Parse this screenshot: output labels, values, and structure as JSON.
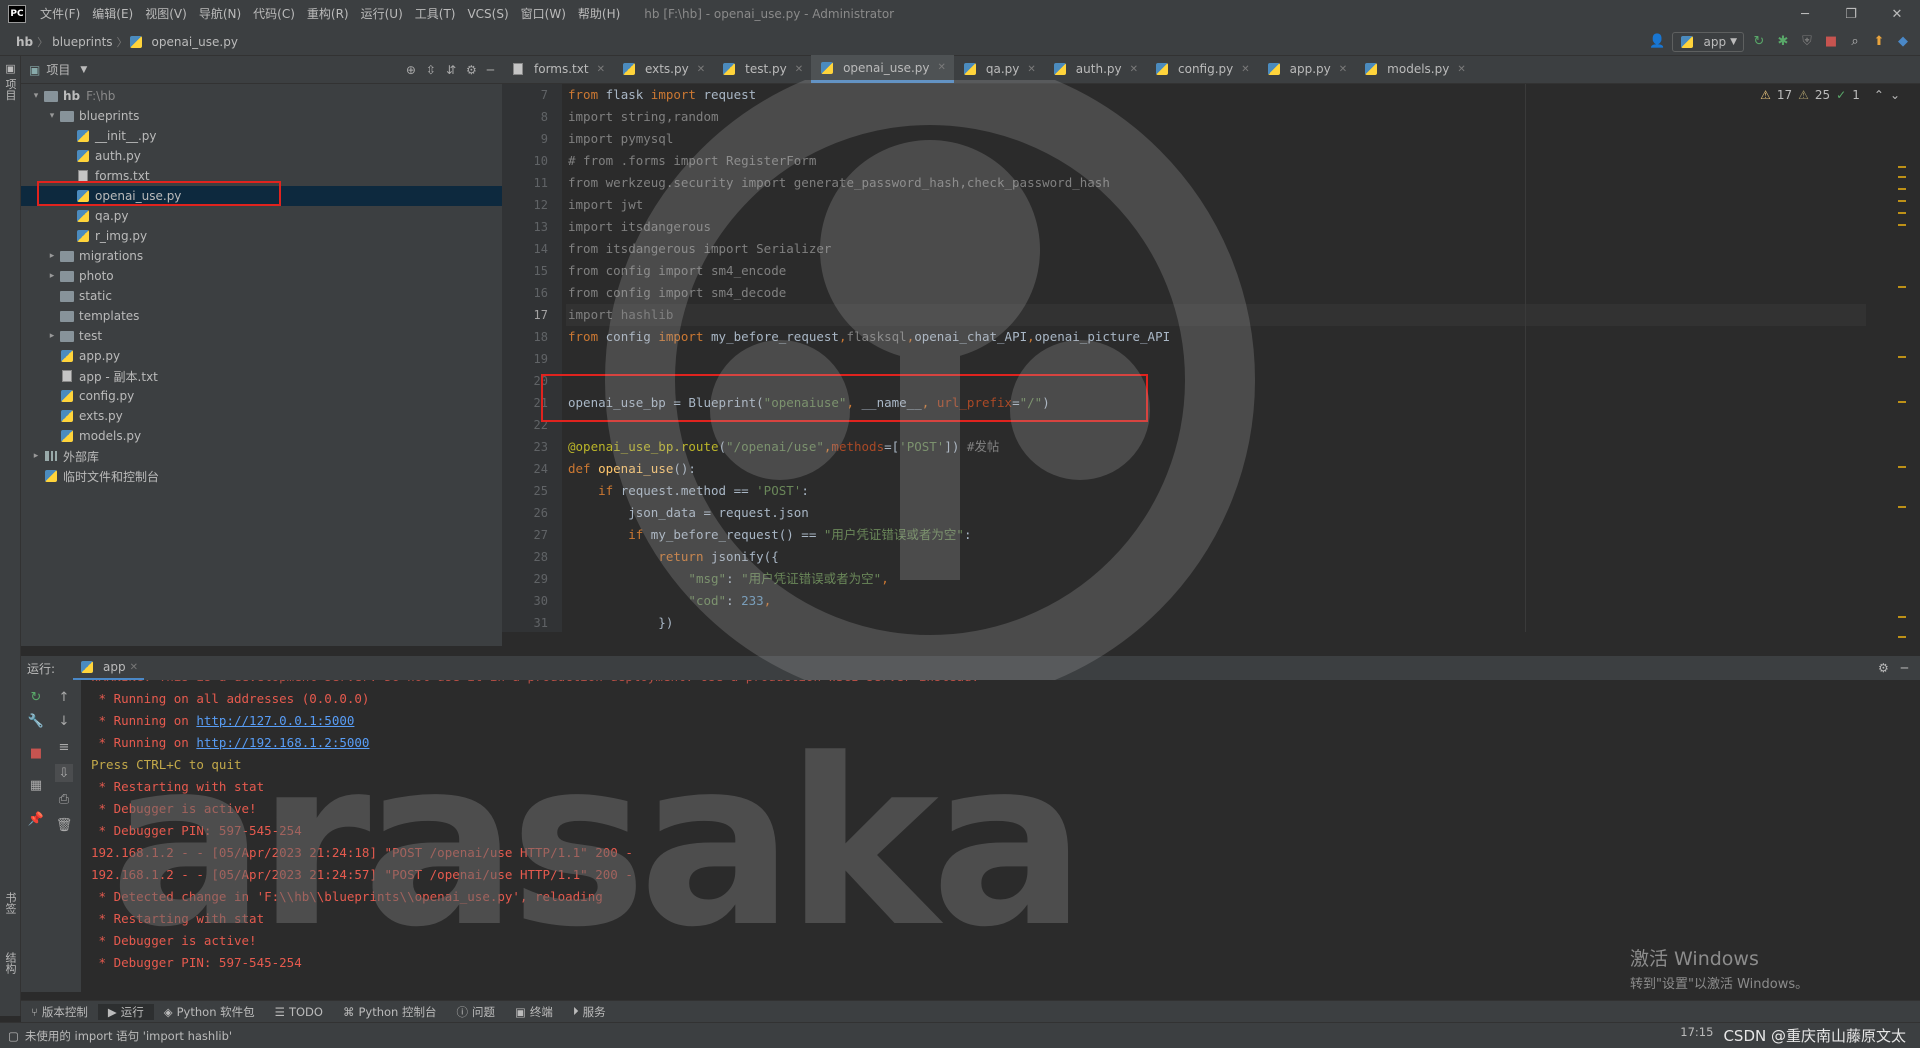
{
  "titlebar": {
    "logo": "PC",
    "menus": [
      "文件(F)",
      "编辑(E)",
      "视图(V)",
      "导航(N)",
      "代码(C)",
      "重构(R)",
      "运行(U)",
      "工具(T)",
      "VCS(S)",
      "窗口(W)",
      "帮助(H)"
    ],
    "window_title": "hb [F:\\hb] - openai_use.py - Administrator"
  },
  "breadcrumb": [
    "hb",
    "blueprints",
    "openai_use.py"
  ],
  "run_config": "app",
  "project": {
    "title": "项目",
    "root": {
      "name": "hb",
      "path": "F:\\hb"
    },
    "tree": [
      {
        "label": "hb",
        "sub": "F:\\hb",
        "type": "folder",
        "depth": 0,
        "open": true
      },
      {
        "label": "blueprints",
        "type": "folder",
        "depth": 1,
        "open": true
      },
      {
        "label": "__init__.py",
        "type": "py",
        "depth": 2
      },
      {
        "label": "auth.py",
        "type": "py",
        "depth": 2
      },
      {
        "label": "forms.txt",
        "type": "txt",
        "depth": 2
      },
      {
        "label": "openai_use.py",
        "type": "py",
        "depth": 2,
        "selected": true
      },
      {
        "label": "qa.py",
        "type": "py",
        "depth": 2
      },
      {
        "label": "r_img.py",
        "type": "py",
        "depth": 2
      },
      {
        "label": "migrations",
        "type": "folder",
        "depth": 1,
        "closed": true
      },
      {
        "label": "photo",
        "type": "folder",
        "depth": 1,
        "closed": true
      },
      {
        "label": "static",
        "type": "folder",
        "depth": 1
      },
      {
        "label": "templates",
        "type": "folder",
        "depth": 1
      },
      {
        "label": "test",
        "type": "folder",
        "depth": 1,
        "closed": true
      },
      {
        "label": "app.py",
        "type": "py",
        "depth": 1
      },
      {
        "label": "app - 副本.txt",
        "type": "txt",
        "depth": 1
      },
      {
        "label": "config.py",
        "type": "py",
        "depth": 1
      },
      {
        "label": "exts.py",
        "type": "py",
        "depth": 1
      },
      {
        "label": "models.py",
        "type": "py",
        "depth": 1
      },
      {
        "label": "外部库",
        "type": "lib",
        "depth": 0,
        "closed": true
      },
      {
        "label": "临时文件和控制台",
        "type": "scratch",
        "depth": 0
      }
    ]
  },
  "editor": {
    "tabs": [
      "forms.txt",
      "exts.py",
      "test.py",
      "openai_use.py",
      "qa.py",
      "auth.py",
      "config.py",
      "app.py",
      "models.py"
    ],
    "active_tab": "openai_use.py",
    "inspections": {
      "warnings": "17",
      "weak_warnings": "25",
      "ok": "1"
    },
    "line_numbers": [
      "7",
      "8",
      "9",
      "10",
      "11",
      "12",
      "13",
      "14",
      "15",
      "16",
      "17",
      "18",
      "19",
      "20",
      "21",
      "22",
      "23",
      "24",
      "25",
      "26",
      "27",
      "28",
      "29",
      "30",
      "31"
    ],
    "current_line": "17"
  },
  "run": {
    "label": "运行:",
    "tab": "app",
    "console": [
      {
        "text": "WARNING: This is a development server. Do not use it in a production deployment. Use a production WSGI server instead.",
        "cls": ""
      },
      {
        "text": " * Running on all addresses (0.0.0.0)",
        "cls": ""
      },
      {
        "pre": " * Running on ",
        "link": "http://127.0.0.1:5000",
        "cls": ""
      },
      {
        "pre": " * Running on ",
        "link": "http://192.168.1.2:5000",
        "cls": ""
      },
      {
        "text": "Press CTRL+C to quit",
        "cls": "y"
      },
      {
        "text": " * Restarting with stat",
        "cls": ""
      },
      {
        "text": " * Debugger is active!",
        "cls": ""
      },
      {
        "text": " * Debugger PIN: 597-545-254",
        "cls": ""
      },
      {
        "text": "192.168.1.2 - - [05/Apr/2023 21:24:18] \"POST /openai/use HTTP/1.1\" 200 -",
        "cls": ""
      },
      {
        "text": "192.168.1.2 - - [05/Apr/2023 21:24:57] \"POST /openai/use HTTP/1.1\" 200 -",
        "cls": ""
      },
      {
        "text": " * Detected change in 'F:\\\\hb\\\\blueprints\\\\openai_use.py', reloading",
        "cls": ""
      },
      {
        "text": " * Restarting with stat",
        "cls": ""
      },
      {
        "text": " * Debugger is active!",
        "cls": ""
      },
      {
        "text": " * Debugger PIN: 597-545-254",
        "cls": ""
      }
    ]
  },
  "windows_activation": {
    "line1": "激活 Windows",
    "line2": "转到\"设置\"以激活 Windows。"
  },
  "bottom_tabs": [
    "版本控制",
    "运行",
    "Python 软件包",
    "TODO",
    "Python 控制台",
    "问题",
    "终端",
    "服务"
  ],
  "active_bottom_tab": "运行",
  "status": {
    "message": "未使用的 import 语句 'import hashlib'",
    "position": "17:15",
    "credit": "CSDN @重庆南山藤原文太"
  },
  "watermark_text": "arasaka",
  "colors": {
    "accent": "#4a88c7",
    "highlight_box": "#e0231e",
    "error_text": "#e65a4e"
  }
}
